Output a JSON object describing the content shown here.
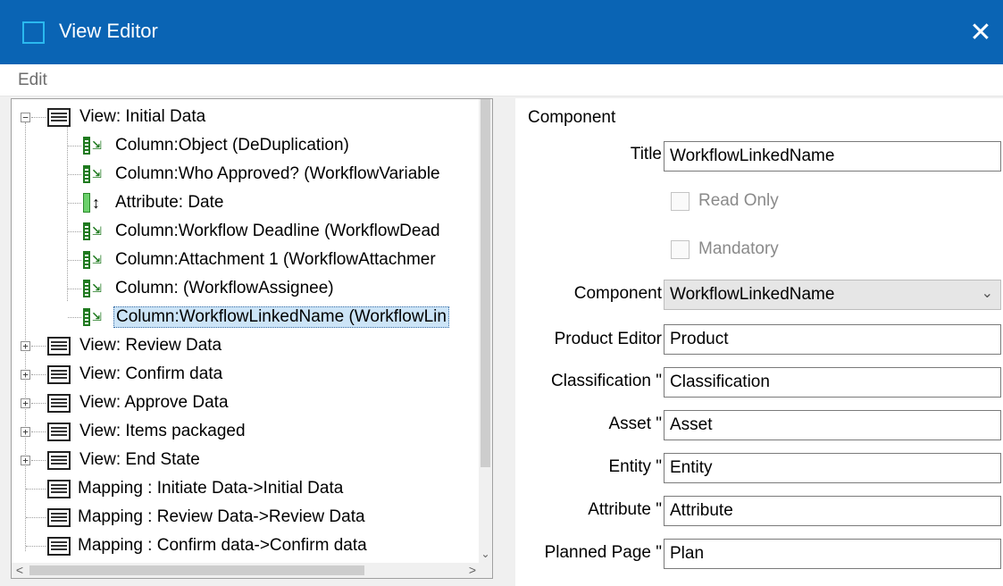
{
  "window": {
    "title": "View Editor",
    "close_glyph": "✕"
  },
  "menu": {
    "edit": "Edit"
  },
  "tree": {
    "items": [
      {
        "kind": "view",
        "label": "View: Initial Data",
        "expanded": true
      },
      {
        "kind": "column",
        "label": "Column:Object (DeDuplication)"
      },
      {
        "kind": "column",
        "label": "Column:Who Approved? (WorkflowVariable"
      },
      {
        "kind": "attribute",
        "label": "Attribute: Date"
      },
      {
        "kind": "column",
        "label": "Column:Workflow Deadline (WorkflowDead"
      },
      {
        "kind": "column",
        "label": "Column:Attachment 1 (WorkflowAttachmer"
      },
      {
        "kind": "column",
        "label": "Column: (WorkflowAssignee)"
      },
      {
        "kind": "column",
        "label": "Column:WorkflowLinkedName (WorkflowLin",
        "selected": true
      },
      {
        "kind": "view",
        "label": "View: Review Data",
        "expanded": false
      },
      {
        "kind": "view",
        "label": "View: Confirm data",
        "expanded": false
      },
      {
        "kind": "view",
        "label": "View: Approve Data",
        "expanded": false
      },
      {
        "kind": "view",
        "label": "View: Items packaged",
        "expanded": false
      },
      {
        "kind": "view",
        "label": "View: End State",
        "expanded": false
      },
      {
        "kind": "mapping",
        "label": "Mapping : Initiate Data->Initial Data"
      },
      {
        "kind": "mapping",
        "label": "Mapping : Review Data->Review Data"
      },
      {
        "kind": "mapping",
        "label": "Mapping : Confirm data->Confirm data"
      }
    ],
    "expand_glyph": "+",
    "collapse_glyph": "−",
    "scroll": {
      "down": "⌄",
      "left": "<",
      "right": ">"
    }
  },
  "props": {
    "group_title": "Component",
    "title_label": "Title",
    "title_value": "WorkflowLinkedName",
    "read_only_label": "Read Only",
    "mandatory_label": "Mandatory",
    "component_label": "Component",
    "component_value": "WorkflowLinkedName",
    "component_chevron": "⌄",
    "product_editor_label": "Product Editor",
    "product_editor_value": "Product",
    "classification_label": "Classification \"",
    "classification_value": "Classification",
    "asset_label": "Asset \"",
    "asset_value": "Asset",
    "entity_label": "Entity \"",
    "entity_value": "Entity",
    "attribute_label": "Attribute \"",
    "attribute_value": "Attribute",
    "planned_page_label": "Planned Page \"",
    "planned_page_value": "Plan"
  }
}
